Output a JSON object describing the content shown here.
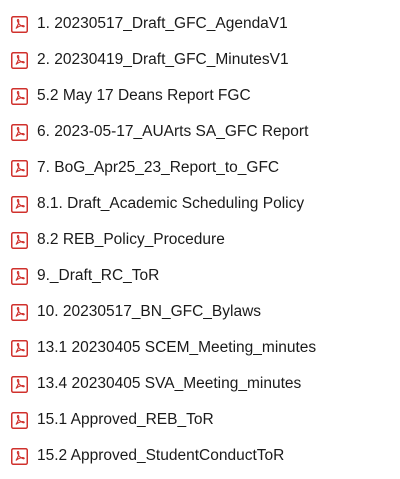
{
  "file_list": {
    "items": [
      {
        "name": "1. 20230517_Draft_GFC_AgendaV1",
        "icon": "pdf-file-icon"
      },
      {
        "name": "2. 20230419_Draft_GFC_MinutesV1",
        "icon": "pdf-file-icon"
      },
      {
        "name": "5.2 May 17 Deans Report FGC",
        "icon": "pdf-file-icon"
      },
      {
        "name": "6. 2023-05-17_AUArts SA_GFC Report",
        "icon": "pdf-file-icon"
      },
      {
        "name": "7. BoG_Apr25_23_Report_to_GFC",
        "icon": "pdf-file-icon"
      },
      {
        "name": "8.1. Draft_Academic Scheduling Policy",
        "icon": "pdf-file-icon"
      },
      {
        "name": "8.2 REB_Policy_Procedure",
        "icon": "pdf-file-icon"
      },
      {
        "name": "9._Draft_RC_ToR",
        "icon": "pdf-file-icon"
      },
      {
        "name": "10. 20230517_BN_GFC_Bylaws",
        "icon": "pdf-file-icon"
      },
      {
        "name": "13.1 20230405 SCEM_Meeting_minutes",
        "icon": "pdf-file-icon"
      },
      {
        "name": "13.4 20230405 SVA_Meeting_minutes",
        "icon": "pdf-file-icon"
      },
      {
        "name": "15.1 Approved_REB_ToR",
        "icon": "pdf-file-icon"
      },
      {
        "name": "15.2 Approved_StudentConductToR",
        "icon": "pdf-file-icon"
      }
    ]
  },
  "colors": {
    "pdf_icon_red": "#d0312d",
    "text": "#1a1a1a",
    "background": "#ffffff"
  }
}
